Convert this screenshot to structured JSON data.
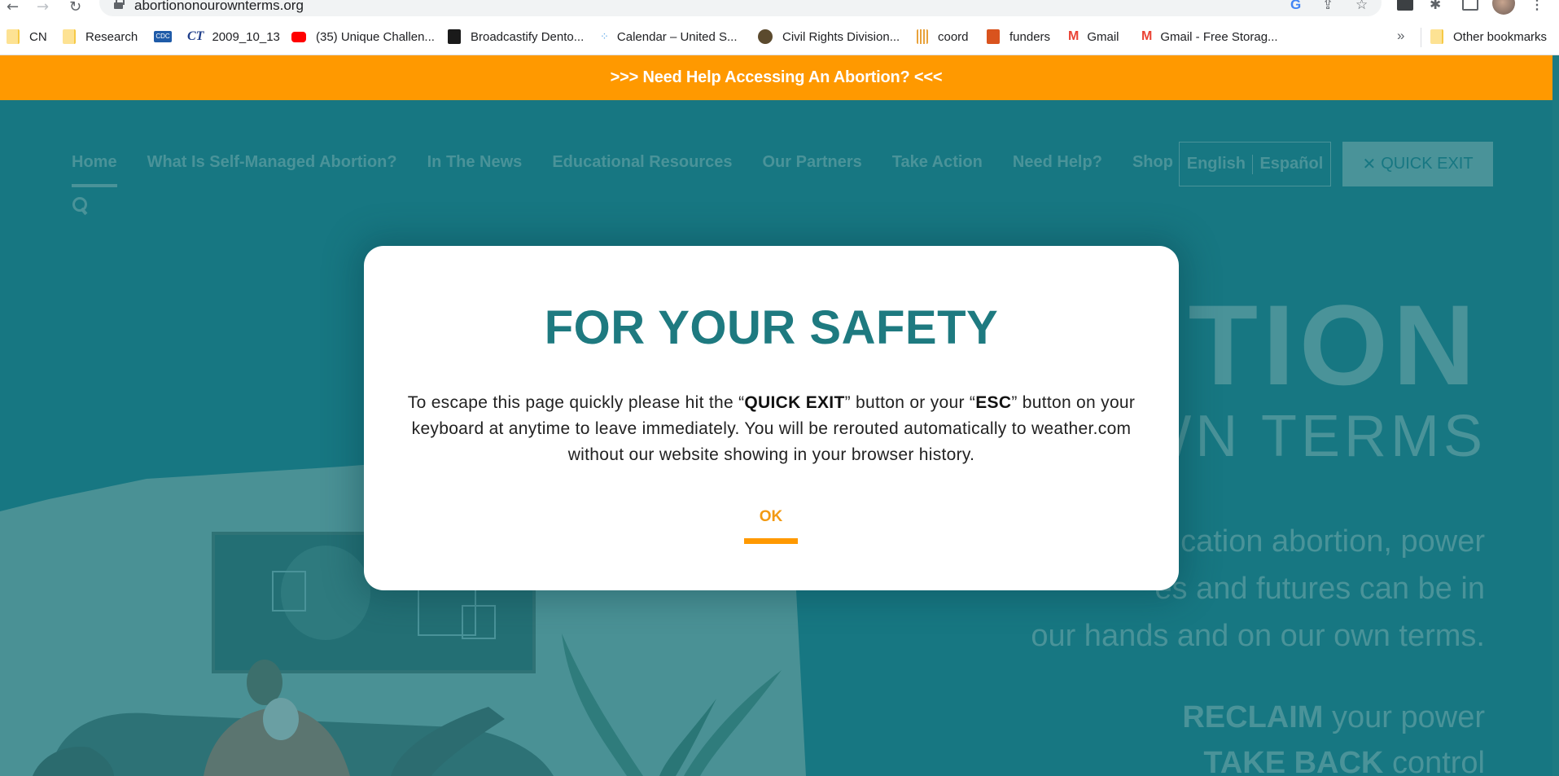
{
  "browser": {
    "url": "abortiononourownterms.org",
    "nav": {
      "back": "back-arrow",
      "forward": "forward-arrow",
      "reload": "reload"
    },
    "bookmarks": [
      {
        "label": "CN",
        "icon": "folder-icon"
      },
      {
        "label": "Research",
        "icon": "folder-icon"
      },
      {
        "label": "",
        "icon": "cdc-icon",
        "icon_text": "CDC"
      },
      {
        "label": "2009_10_13",
        "icon": "ct-icon",
        "icon_text": "CT"
      },
      {
        "label": "(35) Unique Challen...",
        "icon": "youtube-icon"
      },
      {
        "label": "Broadcastify Dento...",
        "icon": "broadcastify-icon"
      },
      {
        "label": "Calendar – United S...",
        "icon": "calendar-icon"
      },
      {
        "label": "Civil Rights Division...",
        "icon": "doj-seal-icon"
      },
      {
        "label": "coord",
        "icon": "coord-icon"
      },
      {
        "label": "funders",
        "icon": "funders-icon"
      },
      {
        "label": "Gmail",
        "icon": "gmail-icon"
      },
      {
        "label": "Gmail - Free Storag...",
        "icon": "gmail-icon"
      }
    ],
    "overflow_label": "»",
    "other_bookmarks": "Other bookmarks"
  },
  "banner": {
    "text": ">>> Need Help Accessing An Abortion? <<<"
  },
  "nav": {
    "items": [
      {
        "label": "Home",
        "active": true
      },
      {
        "label": "What Is Self-Managed Abortion?"
      },
      {
        "label": "In The News"
      },
      {
        "label": "Educational Resources"
      },
      {
        "label": "Our Partners"
      },
      {
        "label": "Take Action"
      },
      {
        "label": "Need Help?"
      },
      {
        "label": "Shop"
      }
    ],
    "lang_en": "English",
    "lang_es": "Español",
    "quick_exit": "QUICK EXIT",
    "quick_exit_icon": "✕"
  },
  "hero": {
    "title_partial": "TION",
    "subtitle_partial": "WN TERMS",
    "para_lines": [
      "cation abortion, power",
      "es and futures can be in",
      "our hands and on our own terms."
    ],
    "tag1_bold": "RECLAIM",
    "tag1_rest": "your power",
    "tag2_bold": "TAKE BACK",
    "tag2_rest": "control"
  },
  "modal": {
    "title": "FOR YOUR SAFETY",
    "body_pre": "To escape this page quickly please hit the “",
    "body_quick_exit": "QUICK EXIT",
    "body_mid": "” button or your “",
    "body_esc": "ESC",
    "body_post": "” button on your keyboard at anytime to leave immediately. You will be rerouted automatically to weather.com without our website showing in your browser history.",
    "ok_label": "OK"
  },
  "colors": {
    "teal": "#177782",
    "orange": "#ff9900",
    "modal_title": "#1e7a80",
    "ok": "#f29a13"
  }
}
